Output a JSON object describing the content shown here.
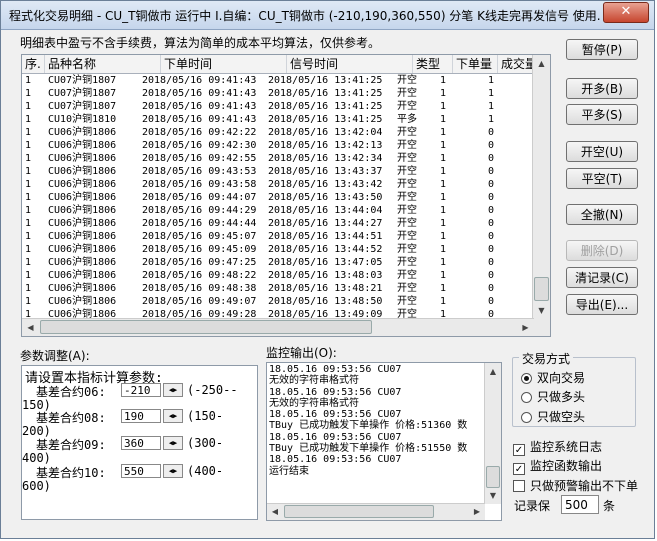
{
  "window": {
    "title": "程式化交易明细 - CU_T铜做市 运行中 I.自编：CU_T铜做市 (-210,190,360,550) 分笔 K线走完再发信号 使用...",
    "close_label": "✕"
  },
  "notice": "明细表中盈亏不含手续费，算法为简单的成本平均算法，仅供参考。",
  "table": {
    "columns": [
      "序.",
      "品种名称",
      "下单时间",
      "信号时间",
      "类型",
      "下单量",
      "成交量"
    ],
    "rows": [
      [
        "1",
        "CU07沪铜1807",
        "2018/05/16 09:41:43",
        "2018/05/16 13:41:25",
        "开空",
        "1",
        "1"
      ],
      [
        "1",
        "CU07沪铜1807",
        "2018/05/16 09:41:43",
        "2018/05/16 13:41:25",
        "开空",
        "1",
        "1"
      ],
      [
        "1",
        "CU07沪铜1807",
        "2018/05/16 09:41:43",
        "2018/05/16 13:41:25",
        "开空",
        "1",
        "1"
      ],
      [
        "1",
        "CU10沪铜1810",
        "2018/05/16 09:41:43",
        "2018/05/16 13:41:25",
        "平多",
        "1",
        "1"
      ],
      [
        "1",
        "CU06沪铜1806",
        "2018/05/16 09:42:22",
        "2018/05/16 13:42:04",
        "开空",
        "1",
        "0"
      ],
      [
        "1",
        "CU06沪铜1806",
        "2018/05/16 09:42:30",
        "2018/05/16 13:42:13",
        "开空",
        "1",
        "0"
      ],
      [
        "1",
        "CU06沪铜1806",
        "2018/05/16 09:42:55",
        "2018/05/16 13:42:34",
        "开空",
        "1",
        "0"
      ],
      [
        "1",
        "CU06沪铜1806",
        "2018/05/16 09:43:53",
        "2018/05/16 13:43:37",
        "开空",
        "1",
        "0"
      ],
      [
        "1",
        "CU06沪铜1806",
        "2018/05/16 09:43:58",
        "2018/05/16 13:43:42",
        "开空",
        "1",
        "0"
      ],
      [
        "1",
        "CU06沪铜1806",
        "2018/05/16 09:44:07",
        "2018/05/16 13:43:50",
        "开空",
        "1",
        "0"
      ],
      [
        "1",
        "CU06沪铜1806",
        "2018/05/16 09:44:29",
        "2018/05/16 13:44:04",
        "开空",
        "1",
        "0"
      ],
      [
        "1",
        "CU06沪铜1806",
        "2018/05/16 09:44:44",
        "2018/05/16 13:44:27",
        "开空",
        "1",
        "0"
      ],
      [
        "1",
        "CU06沪铜1806",
        "2018/05/16 09:45:07",
        "2018/05/16 13:44:51",
        "开空",
        "1",
        "0"
      ],
      [
        "1",
        "CU06沪铜1806",
        "2018/05/16 09:45:09",
        "2018/05/16 13:44:52",
        "开空",
        "1",
        "0"
      ],
      [
        "1",
        "CU06沪铜1806",
        "2018/05/16 09:47:25",
        "2018/05/16 13:47:05",
        "开空",
        "1",
        "0"
      ],
      [
        "1",
        "CU06沪铜1806",
        "2018/05/16 09:48:22",
        "2018/05/16 13:48:03",
        "开空",
        "1",
        "0"
      ],
      [
        "1",
        "CU06沪铜1806",
        "2018/05/16 09:48:38",
        "2018/05/16 13:48:21",
        "开空",
        "1",
        "0"
      ],
      [
        "1",
        "CU06沪铜1806",
        "2018/05/16 09:49:07",
        "2018/05/16 13:48:50",
        "开空",
        "1",
        "0"
      ],
      [
        "1",
        "CU06沪铜1806",
        "2018/05/16 09:49:28",
        "2018/05/16 13:49:09",
        "开空",
        "1",
        "0"
      ]
    ]
  },
  "buttons": {
    "pause": "暂停(P)",
    "open_long": "开多(B)",
    "close_long": "平多(S)",
    "open_short": "开空(U)",
    "close_short": "平空(T)",
    "cancel_all": "全撤(N)",
    "delete": "删除(D)",
    "clear_records": "清记录(C)",
    "export": "导出(E)..."
  },
  "params": {
    "label": "参数调整(A):",
    "title": "请设置本指标计算参数:",
    "items": [
      {
        "name": "基差合约06:",
        "value": "-210",
        "range_start": "(-250--",
        "range_end": "150)"
      },
      {
        "name": "基差合约08:",
        "value": "190",
        "range_start": "(150-",
        "range_end": "200)"
      },
      {
        "name": "基差合约09:",
        "value": "360",
        "range_start": "(300-",
        "range_end": "400)"
      },
      {
        "name": "基差合约10:",
        "value": "550",
        "range_start": "(400-",
        "range_end": "600)"
      }
    ]
  },
  "monitor": {
    "label": "监控输出(O):",
    "lines": [
      "18.05.16 09:53:56 CU07",
      "无效的字符串格式符",
      "18.05.16 09:53:56 CU07",
      "无效的字符串格式符",
      "18.05.16 09:53:56 CU07",
      "TBuy 已成功触发下单操作 价格:51360 数",
      "18.05.16 09:53:56 CU07",
      "TBuy 已成功触发下单操作 价格:51550 数",
      "18.05.16 09:53:56 CU07",
      "运行结束"
    ]
  },
  "trade_mode": {
    "legend": "交易方式",
    "options": [
      "双向交易",
      "只做多头",
      "只做空头"
    ],
    "selected": "双向交易"
  },
  "options": {
    "monitor_log": "监控系统日志",
    "monitor_func": "监控函数输出",
    "alert_only": "只做预警输出不下单",
    "monitor_log_checked": true,
    "monitor_func_checked": true,
    "alert_only_checked": false
  },
  "record": {
    "label": "记录保",
    "value": "500",
    "unit": "条"
  }
}
